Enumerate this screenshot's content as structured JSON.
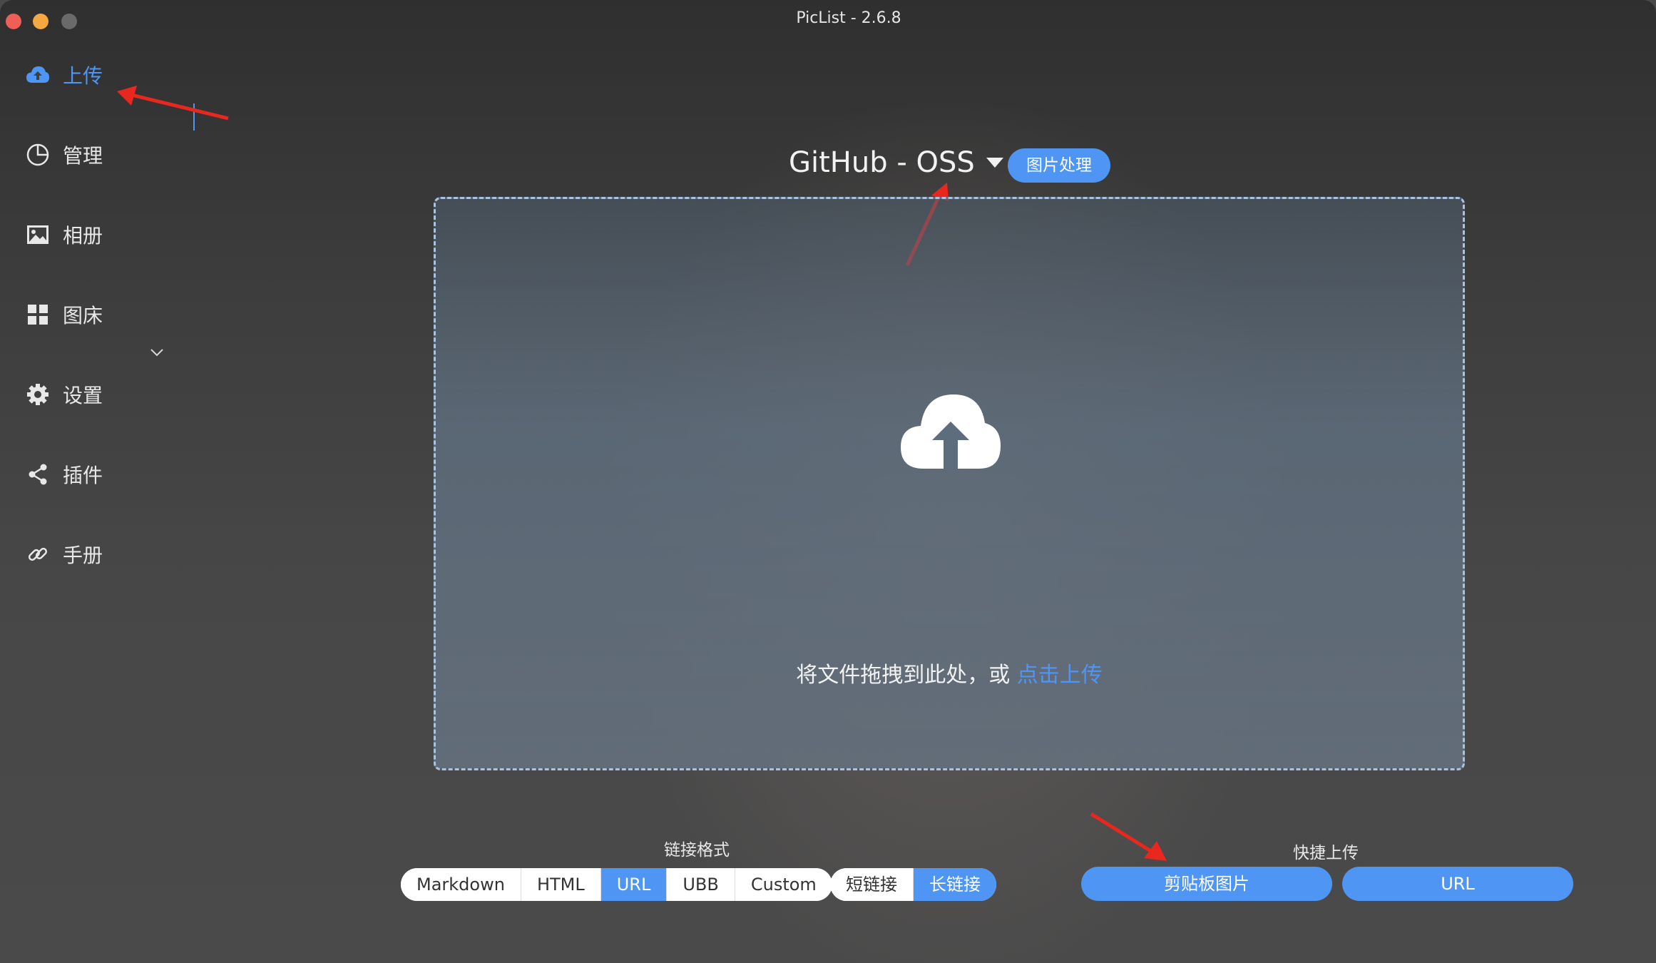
{
  "window": {
    "title": "PicList - 2.6.8"
  },
  "sidebar": {
    "items": [
      {
        "label": "上传",
        "icon": "cloud-upload-icon",
        "active": true
      },
      {
        "label": "管理",
        "icon": "pie-chart-icon"
      },
      {
        "label": "相册",
        "icon": "picture-icon"
      },
      {
        "label": "图床",
        "icon": "grid-icon",
        "expandable": true
      },
      {
        "label": "设置",
        "icon": "gear-icon"
      },
      {
        "label": "插件",
        "icon": "share-icon"
      },
      {
        "label": "手册",
        "icon": "link-icon"
      }
    ]
  },
  "upload": {
    "picbed_label": "GitHub - OSS",
    "image_process_label": "图片处理",
    "drop_text": "将文件拖拽到此处，或 ",
    "click_upload": "点击上传"
  },
  "link_format": {
    "label": "链接格式",
    "options": [
      "Markdown",
      "HTML",
      "URL",
      "UBB",
      "Custom"
    ],
    "selected": "URL",
    "length_options": [
      "短链接",
      "长链接"
    ],
    "length_selected": "长链接"
  },
  "quick_upload": {
    "label": "快捷上传",
    "clipboard_label": "剪贴板图片",
    "url_label": "URL"
  },
  "colors": {
    "accent": "#4f95f3",
    "annotation": "#e8271e"
  }
}
